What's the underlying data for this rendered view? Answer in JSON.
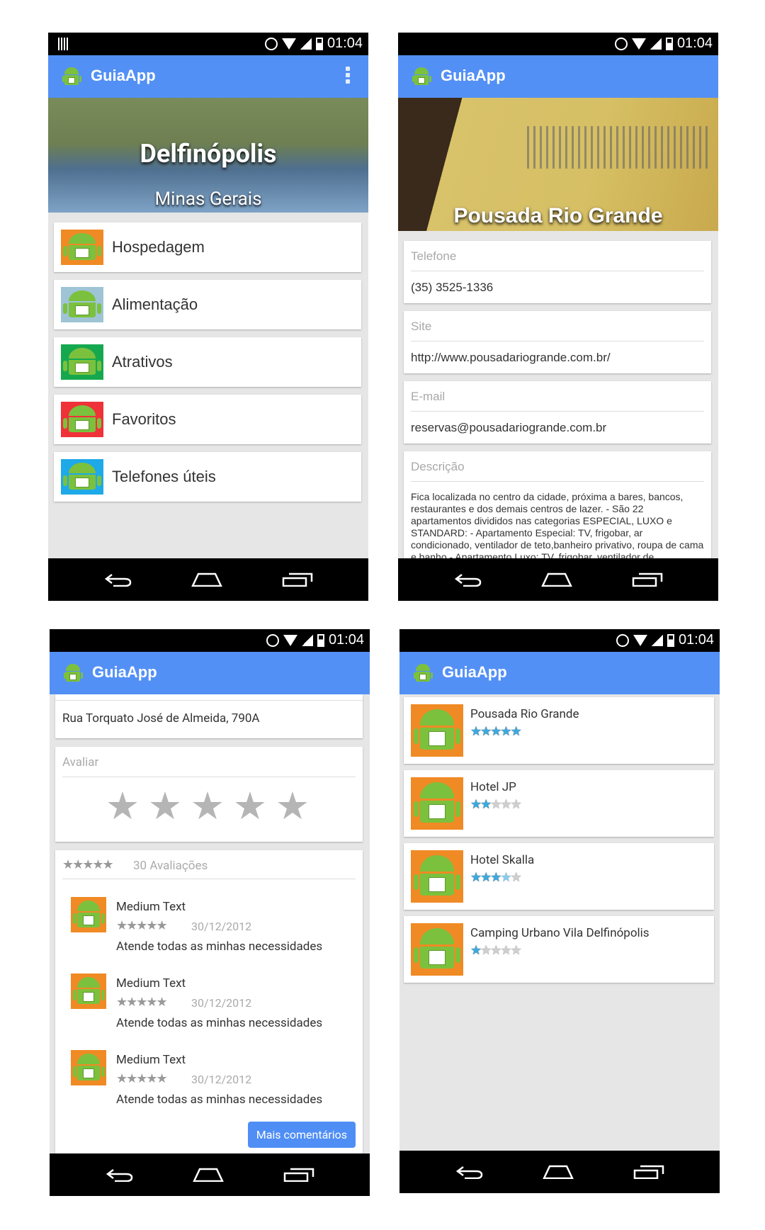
{
  "status_time": "01:04",
  "app_title": "GuiaApp",
  "home": {
    "city": "Delfinópolis",
    "state": "Minas Gerais",
    "menu": [
      {
        "label": "Hospedagem",
        "color": "#f08a24"
      },
      {
        "label": "Alimentação",
        "color": "#9ec4d6"
      },
      {
        "label": "Atrativos",
        "color": "#15a84f"
      },
      {
        "label": "Favoritos",
        "color": "#ef3138"
      },
      {
        "label": "Telefones úteis",
        "color": "#1ea9e8"
      }
    ]
  },
  "detail": {
    "place_name": "Pousada Rio Grande",
    "phone_label": "Telefone",
    "phone": "(35) 3525-1336",
    "site_label": "Site",
    "site": "http://www.pousadariogrande.com.br/",
    "email_label": "E-mail",
    "email": "reservas@pousadariogrande.com.br",
    "desc_label": "Descrição",
    "description": "Fica localizada no centro da cidade, próxima a bares, bancos, restaurantes e dos demais centros de lazer.  - São 22 apartamentos divididos nas categorias ESPECIAL, LUXO e STANDARD: - Apartamento Especial: TV, frigobar, ar condicionado, ventilador de teto,banheiro privativo, roupa de cama e banho - Apartamento Luxo: TV, frigobar, ventilador de"
  },
  "reviews_screen": {
    "address": "Rua Torquato José de Almeida, 790A",
    "rate_label": "Avaliar",
    "reviews_count": "30 Avaliações",
    "reviews": [
      {
        "name": "Medium Text",
        "date": "30/12/2012",
        "text": "Atende todas as minhas necessidades"
      },
      {
        "name": "Medium Text",
        "date": "30/12/2012",
        "text": "Atende todas as minhas necessidades"
      },
      {
        "name": "Medium Text",
        "date": "30/12/2012",
        "text": "Atende todas as minhas necessidades"
      }
    ],
    "more_label": "Mais comentários"
  },
  "listing": [
    {
      "name": "Pousada Rio Grande",
      "rating": 5
    },
    {
      "name": "Hotel JP",
      "rating": 2
    },
    {
      "name": "Hotel Skalla",
      "rating": 3.5
    },
    {
      "name": "Camping Urbano Vila Delfinópolis",
      "rating": 1
    }
  ]
}
